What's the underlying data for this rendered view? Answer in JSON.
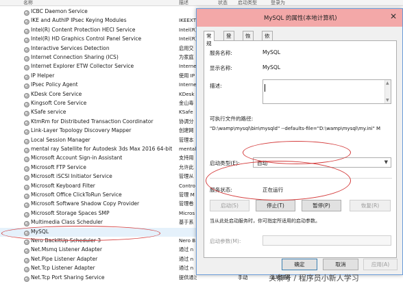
{
  "header": {
    "col_name": "名称",
    "col_desc": "描述",
    "col_status": "状态",
    "col_type": "启动类型",
    "col_logon": "登录为"
  },
  "services": [
    {
      "name": "ICBC Daemon Service",
      "desc": "",
      "status": "",
      "type": "",
      "logon": ""
    },
    {
      "name": "IKE and AuthIP IPsec Keying Modules",
      "desc": "IKEEXT",
      "status": "",
      "type": "",
      "logon": ""
    },
    {
      "name": "Intel(R) Content Protection HECI Service",
      "desc": "Intel(R)",
      "status": "",
      "type": "",
      "logon": ""
    },
    {
      "name": "Intel(R) HD Graphics Control Panel Service",
      "desc": "Intel(R)",
      "status": "",
      "type": "",
      "logon": ""
    },
    {
      "name": "Interactive Services Detection",
      "desc": "启用交",
      "status": "",
      "type": "",
      "logon": ""
    },
    {
      "name": "Internet Connection Sharing (ICS)",
      "desc": "为家庭",
      "status": "",
      "type": "",
      "logon": ""
    },
    {
      "name": "Internet Explorer ETW Collector Service",
      "desc": "Interne",
      "status": "",
      "type": "",
      "logon": ""
    },
    {
      "name": "IP Helper",
      "desc": "使用 IP",
      "status": "",
      "type": "",
      "logon": ""
    },
    {
      "name": "IPsec Policy Agent",
      "desc": "Interne",
      "status": "",
      "type": "",
      "logon": ""
    },
    {
      "name": "KDesk Core Service",
      "desc": "KDesk",
      "status": "",
      "type": "",
      "logon": ""
    },
    {
      "name": "Kingsoft Core Service",
      "desc": "金山毒",
      "status": "",
      "type": "",
      "logon": ""
    },
    {
      "name": "KSafe service",
      "desc": "KSafe",
      "status": "",
      "type": "",
      "logon": ""
    },
    {
      "name": "KtmRm for Distributed Transaction Coordinator",
      "desc": "协调分",
      "status": "",
      "type": "",
      "logon": ""
    },
    {
      "name": "Link-Layer Topology Discovery Mapper",
      "desc": "创建网",
      "status": "",
      "type": "",
      "logon": ""
    },
    {
      "name": "Local Session Manager",
      "desc": "管理本",
      "status": "",
      "type": "",
      "logon": ""
    },
    {
      "name": "mental ray Satellite for Autodesk 3ds Max 2016 64-bit",
      "desc": "mental",
      "status": "",
      "type": "",
      "logon": ""
    },
    {
      "name": "Microsoft Account Sign-in Assistant",
      "desc": "支持用",
      "status": "",
      "type": "",
      "logon": ""
    },
    {
      "name": "Microsoft FTP Service",
      "desc": "允许此",
      "status": "",
      "type": "",
      "logon": ""
    },
    {
      "name": "Microsoft iSCSI Initiator Service",
      "desc": "管理从",
      "status": "",
      "type": "",
      "logon": ""
    },
    {
      "name": "Microsoft Keyboard Filter",
      "desc": "Contro",
      "status": "",
      "type": "",
      "logon": ""
    },
    {
      "name": "Microsoft Office ClickToRun Service",
      "desc": "管理 M",
      "status": "",
      "type": "",
      "logon": ""
    },
    {
      "name": "Microsoft Software Shadow Copy Provider",
      "desc": "管理卷",
      "status": "",
      "type": "",
      "logon": ""
    },
    {
      "name": "Microsoft Storage Spaces SMP",
      "desc": "Micros",
      "status": "",
      "type": "",
      "logon": ""
    },
    {
      "name": "Multimedia Class Scheduler",
      "desc": "基于系",
      "status": "",
      "type": "",
      "logon": ""
    },
    {
      "name": "MySQL",
      "desc": "",
      "status": "",
      "type": "",
      "logon": ""
    },
    {
      "name": "Nero BackItUp Scheduler 3",
      "desc": "Nero B",
      "status": "",
      "type": "",
      "logon": ""
    },
    {
      "name": "Net.Msmq Listener Adapter",
      "desc": "通过 n",
      "status": "",
      "type": "",
      "logon": ""
    },
    {
      "name": "Net.Pipe Listener Adapter",
      "desc": "通过 n",
      "status": "",
      "type": "",
      "logon": ""
    },
    {
      "name": "Net.Tcp Listener Adapter",
      "desc": "通过 n",
      "status": "",
      "type": "",
      "logon": ""
    },
    {
      "name": "Net.Tcp Port Sharing Service",
      "desc": "提供通过 ne...",
      "status": "",
      "type": "手动",
      "logon": "本地服务"
    }
  ],
  "dialog": {
    "title": "MySQL 的属性(本地计算机)",
    "close": "✕",
    "tabs": [
      "常规",
      "登录",
      "恢复",
      "依存关系"
    ],
    "service_name_label": "服务名称:",
    "service_name": "MySQL",
    "display_name_label": "显示名称:",
    "display_name": "MySQL",
    "description_label": "描述:",
    "exe_path_label": "可执行文件的路径:",
    "exe_path": "\"D:\\wamp\\mysql\\bin\\mysqld\" --defaults-file=\"D:\\wamp\\mysql\\my.ini\" M",
    "startup_type_label": "启动类型(E):",
    "startup_type": "自动",
    "status_label": "服务状态:",
    "status": "正在运行",
    "start_btn": "启动(S)",
    "stop_btn": "停止(T)",
    "pause_btn": "暂停(P)",
    "resume_btn": "恢复(R)",
    "hint": "当从此处启动服务时，你可指定所适用的启动参数。",
    "params_label": "启动参数(M):",
    "ok_btn": "确定",
    "cancel_btn": "取消",
    "apply_btn": "应用(A)"
  },
  "watermark": "头条号 / 程序员小新人学习",
  "colors": {
    "annotation": "#d43b3b",
    "selection": "#e5f1fb",
    "titlebar": "#f3a8a8"
  }
}
